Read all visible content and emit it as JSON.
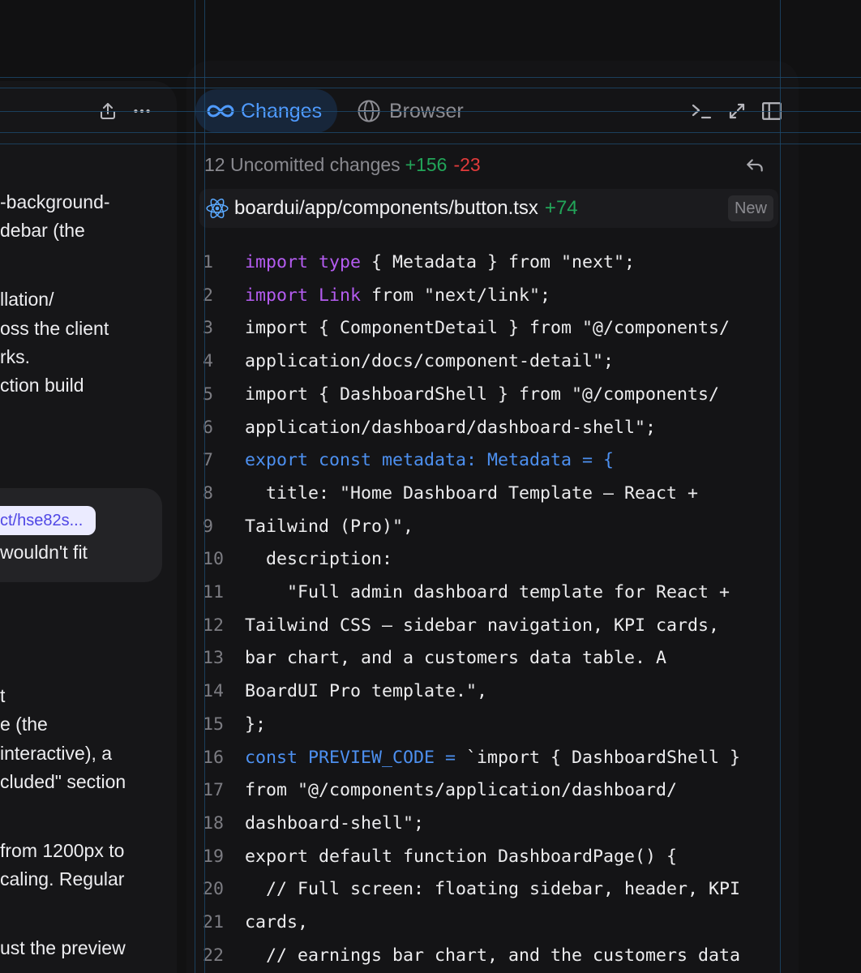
{
  "left": {
    "chat_lines": [
      "-background-",
      "debar (the",
      "llation/",
      "oss the client",
      "rks.",
      "ction build",
      "t",
      "e (the",
      " interactive), a",
      "cluded\" section",
      "from 1200px to",
      "caling. Regular",
      "ust the preview"
    ],
    "link_chip": "ct/hse82s...",
    "bubble_text": " wouldn't fit"
  },
  "tabs": {
    "changes": "Changes",
    "browser": "Browser"
  },
  "summary": {
    "text": "12 Uncomitted changes",
    "additions": "+156",
    "deletions": "-23"
  },
  "file": {
    "path": "boardui/app/components/button.tsx",
    "additions": "+74",
    "badge": "New"
  },
  "code_lines": [
    {
      "n": "1",
      "parts": [
        [
          "kw",
          "import type"
        ],
        [
          "",
          " { Metadata } from \"next\";"
        ]
      ]
    },
    {
      "n": "2",
      "parts": [
        [
          "kw",
          "import Link"
        ],
        [
          "",
          " from \"next/link\";"
        ]
      ]
    },
    {
      "n": "3",
      "parts": [
        [
          "",
          "import { ComponentDetail } from \"@/components/"
        ]
      ]
    },
    {
      "n": "4",
      "parts": [
        [
          "",
          "application/docs/component-detail\";"
        ]
      ]
    },
    {
      "n": "5",
      "parts": [
        [
          "",
          "import { DashboardShell } from \"@/components/"
        ]
      ]
    },
    {
      "n": "6",
      "parts": [
        [
          "",
          "application/dashboard/dashboard-shell\";"
        ]
      ]
    },
    {
      "n": "7",
      "parts": [
        [
          "bl",
          "export const metadata: Metadata = {"
        ]
      ]
    },
    {
      "n": "8",
      "parts": [
        [
          "",
          "  title: \"Home Dashboard Template — React +"
        ]
      ]
    },
    {
      "n": "9",
      "parts": [
        [
          "",
          "Tailwind (Pro)\","
        ]
      ]
    },
    {
      "n": "10",
      "parts": [
        [
          "",
          "  description:"
        ]
      ]
    },
    {
      "n": "11",
      "parts": [
        [
          "",
          "    \"Full admin dashboard template for React +"
        ]
      ]
    },
    {
      "n": "12",
      "parts": [
        [
          "",
          "Tailwind CSS — sidebar navigation, KPI cards,"
        ]
      ]
    },
    {
      "n": "13",
      "parts": [
        [
          "",
          "bar chart, and a customers data table. A"
        ]
      ]
    },
    {
      "n": "14",
      "parts": [
        [
          "",
          "BoardUI Pro template.\","
        ]
      ]
    },
    {
      "n": "15",
      "parts": [
        [
          "",
          "};"
        ]
      ]
    },
    {
      "n": "16",
      "parts": [
        [
          "bl",
          "const PREVIEW_CODE ="
        ],
        [
          "",
          " `import { DashboardShell }"
        ]
      ]
    },
    {
      "n": "17",
      "parts": [
        [
          "",
          "from \"@/components/application/dashboard/"
        ]
      ]
    },
    {
      "n": "18",
      "parts": [
        [
          "",
          "dashboard-shell\";"
        ]
      ]
    },
    {
      "n": "19",
      "parts": [
        [
          "",
          "export default function DashboardPage() {"
        ]
      ]
    },
    {
      "n": "20",
      "parts": [
        [
          "",
          "  // Full screen: floating sidebar, header, KPI"
        ]
      ]
    },
    {
      "n": "21",
      "parts": [
        [
          "",
          "cards,"
        ]
      ]
    },
    {
      "n": "22",
      "parts": [
        [
          "",
          "  // earnings bar chart, and the customers data"
        ]
      ]
    }
  ],
  "icons": [
    "share-icon",
    "more-icon",
    "infinity-icon",
    "globe-icon",
    "terminal-icon",
    "expand-icon",
    "sidebar-icon",
    "undo-icon",
    "react-icon"
  ],
  "colors": {
    "background": "#111112",
    "accent_blue": "#4f9bff",
    "keyword_purple": "#b45cf0",
    "keyword_blue": "#4d90f0",
    "addition_green": "#22a559",
    "deletion_red": "#e23b3b"
  }
}
